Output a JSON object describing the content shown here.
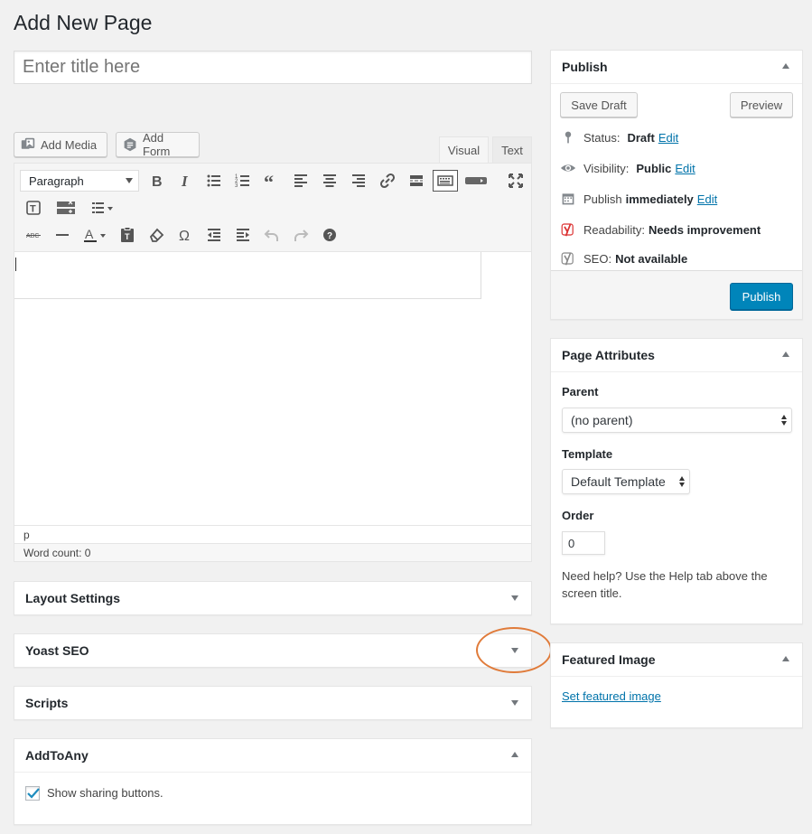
{
  "page": {
    "title": "Add New Page"
  },
  "title_field": {
    "placeholder": "Enter title here",
    "value": ""
  },
  "media_buttons": {
    "add_media": "Add Media",
    "add_form": "Add Form"
  },
  "editor_tabs": {
    "visual": "Visual",
    "text": "Text",
    "active": "visual"
  },
  "toolbar": {
    "format_select": "Paragraph",
    "row1_icons": [
      "bold-icon",
      "italic-icon",
      "bullet-list-icon",
      "numbered-list-icon",
      "blockquote-icon",
      "align-left-icon",
      "align-center-icon",
      "align-right-icon",
      "link-icon",
      "read-more-icon",
      "toolbar-toggle-icon",
      "shortcode-icon",
      "fullscreen-icon"
    ],
    "row2_icons": [
      "text-box-icon",
      "table-icon",
      "list-dropdown-icon"
    ],
    "row3_icons": [
      "strikethrough-icon",
      "horizontal-line-icon",
      "text-color-icon",
      "paste-text-icon",
      "clear-formatting-icon",
      "special-character-icon",
      "outdent-icon",
      "indent-icon",
      "undo-icon",
      "redo-icon",
      "help-icon"
    ]
  },
  "editor_status": {
    "path": "p",
    "word_count": "Word count: 0"
  },
  "left_boxes": {
    "layout_settings": "Layout Settings",
    "yoast_seo": "Yoast SEO",
    "scripts": "Scripts",
    "addtoany": {
      "title": "AddToAny",
      "checkbox_label": "Show sharing buttons.",
      "checked": true
    }
  },
  "publish": {
    "title": "Publish",
    "save_draft": "Save Draft",
    "preview": "Preview",
    "status_label": "Status:",
    "status_value": "Draft",
    "visibility_label": "Visibility:",
    "visibility_value": "Public",
    "publish_label": "Publish",
    "publish_value": "immediately",
    "edit": "Edit",
    "readability_label": "Readability:",
    "readability_value": "Needs improvement",
    "seo_label": "SEO:",
    "seo_value": "Not available",
    "publish_button": "Publish"
  },
  "page_attributes": {
    "title": "Page Attributes",
    "parent_label": "Parent",
    "parent_value": "(no parent)",
    "template_label": "Template",
    "template_value": "Default Template",
    "order_label": "Order",
    "order_value": "0",
    "help_text": "Need help? Use the Help tab above the screen title."
  },
  "featured_image": {
    "title": "Featured Image",
    "link": "Set featured image"
  },
  "colors": {
    "primary": "#0085ba",
    "link": "#0073aa",
    "highlight": "#e07b3a",
    "yoast_red": "#dc3232"
  }
}
